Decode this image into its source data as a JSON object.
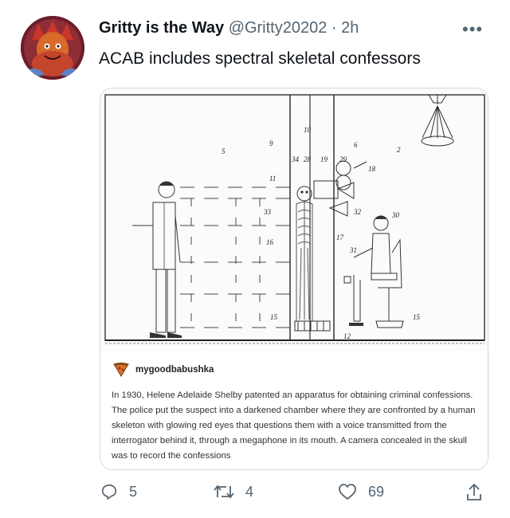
{
  "tweet": {
    "display_name": "Gritty is the Way",
    "handle": "@Gritty20202",
    "separator": "·",
    "time": "2h",
    "more": "•••",
    "text": "ACAB includes spectral skeletal confessors"
  },
  "embed": {
    "patent_labels": {
      "n10": "10",
      "n5": "5",
      "n9": "9",
      "n6": "6",
      "n2": "2",
      "n34": "34",
      "n28": "28",
      "n19": "19",
      "n29": "29",
      "n11": "11",
      "n18": "18",
      "n33": "33",
      "n32": "32",
      "n30": "30",
      "n16": "16",
      "n17": "17",
      "n31": "31",
      "n15": "15",
      "n15b": "15",
      "n12": "12"
    },
    "source_user": "mygoodbabushka",
    "caption": "In 1930, Helene Adelaide Shelby patented an apparatus for obtaining criminal confessions. The police put the suspect into a darkened chamber where they are confronted by a human skeleton with glowing red eyes that questions them with a voice transmitted from the interrogator behind it, through a megaphone in its mouth. A camera concealed in the skull was to record the confessions"
  },
  "actions": {
    "reply_count": "5",
    "retweet_count": "4",
    "like_count": "69"
  },
  "colors": {
    "text_primary": "#0f1419",
    "text_secondary": "#536471",
    "card_border": "#cfd9de",
    "avatar_bg": "#7a1f2a"
  },
  "icons": [
    "reply-icon",
    "retweet-icon",
    "like-icon",
    "share-icon",
    "more-icon"
  ]
}
